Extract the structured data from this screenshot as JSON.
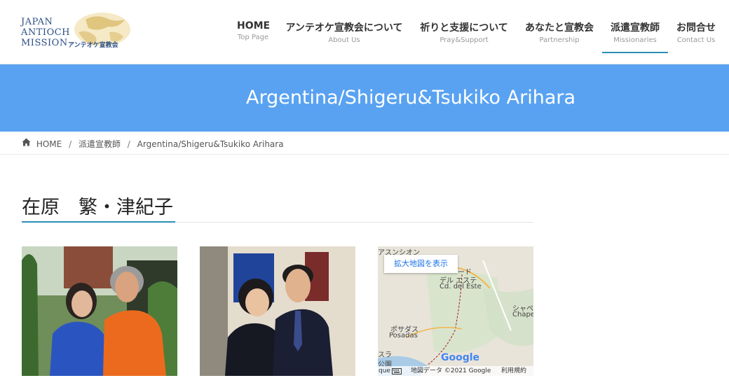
{
  "logo": {
    "line1": "JAPAN",
    "line2": "ANTIOCH",
    "line3": "MISSION",
    "jp": "アンテオケ宣教会"
  },
  "nav": [
    {
      "label": "HOME",
      "sub": "Top Page"
    },
    {
      "label": "アンテオケ宣教会について",
      "sub": "About Us"
    },
    {
      "label": "祈りと支援について",
      "sub": "Pray&Support"
    },
    {
      "label": "あなたと宣教会",
      "sub": "Partnership"
    },
    {
      "label": "派遣宣教師",
      "sub": "Missionaries"
    },
    {
      "label": "お問合せ",
      "sub": "Contact Us"
    }
  ],
  "hero": {
    "title": "Argentina/Shigeru&Tsukiko Arihara"
  },
  "breadcrumb": {
    "home": "HOME",
    "parent": "派遣宣教師",
    "current": "Argentina/Shigeru&Tsukiko Arihara",
    "sep": "/"
  },
  "content": {
    "title": "在原　繁・津紀子"
  },
  "map": {
    "button": "拡大地図を表示",
    "labels": {
      "asuncion": "アスンシオン",
      "ciudad_jp": "デル エステ",
      "ciudad_jp2": "ード",
      "ciudad_en": "Cd. del Este",
      "posadas_jp": "ポサダス",
      "posadas_en": "Posadas",
      "chape_jp": "シャペ",
      "chape_en": "Chape",
      "kura": "スラ",
      "park": "公園",
      "que": "que"
    },
    "google": "Google",
    "footer_data": "地図データ ©2021 Google",
    "footer_terms": "利用規約"
  },
  "colors": {
    "hero": "#59a2f1",
    "accent": "#2b8fb5",
    "brand": "#2d4f86"
  }
}
